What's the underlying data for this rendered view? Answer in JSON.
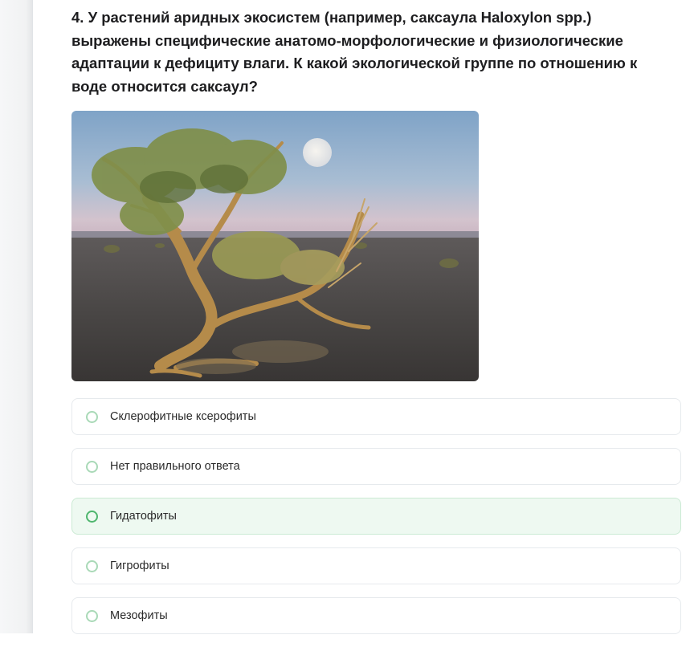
{
  "question": {
    "text": "4. У растений аридных экосистем (например, саксаула Haloxylon spp.) выражены специфические анатомо-морфологические и физиологические адаптации к дефициту влаги. К какой экологической группе по отношению к воде относится саксаул?"
  },
  "image": {
    "subject": "saxaul-tree-in-desert"
  },
  "options": [
    {
      "label": "Склерофитные ксерофиты",
      "selected": false
    },
    {
      "label": "Нет правильного ответа",
      "selected": false
    },
    {
      "label": "Гидатофиты",
      "selected": true
    },
    {
      "label": "Гигрофиты",
      "selected": false
    },
    {
      "label": "Мезофиты",
      "selected": false
    }
  ],
  "colors": {
    "accent": "#4fb66e",
    "selected_bg": "#eef9f1",
    "border": "#e6eaed"
  }
}
